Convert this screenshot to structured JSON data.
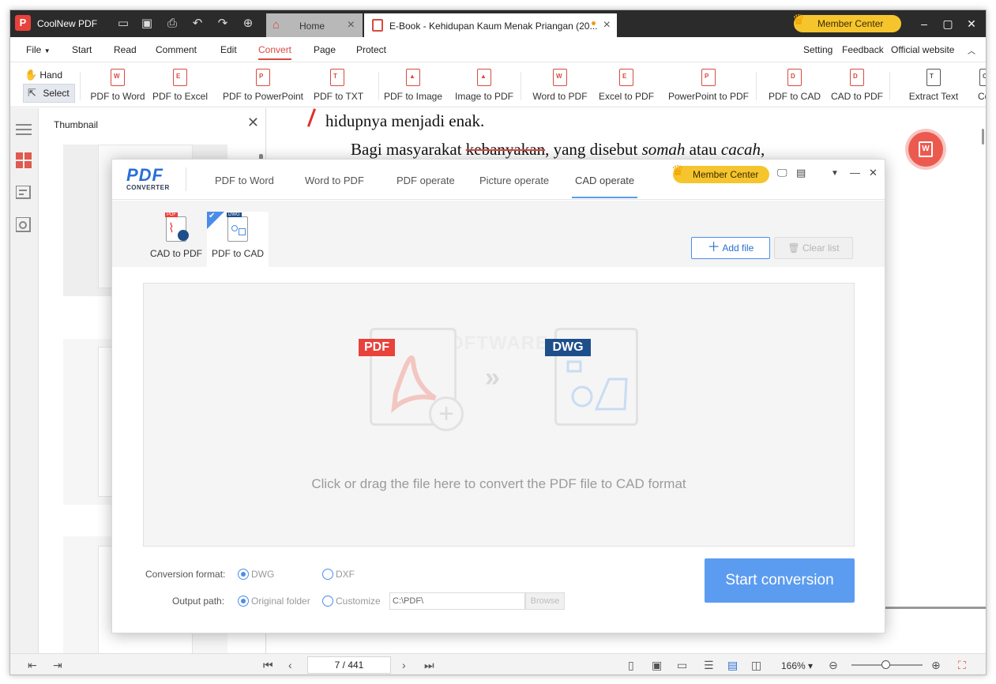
{
  "app": {
    "name": "CoolNew PDF",
    "logo_letter": "P",
    "tabs": [
      {
        "label": "Home"
      },
      {
        "label": "E-Book - Kehidupan Kaum Menak Priangan (20..."
      }
    ],
    "member_center": "Member Center",
    "accent": "#d84a40"
  },
  "menu": {
    "items": [
      "File",
      "Start",
      "Read",
      "Comment",
      "Edit",
      "Convert",
      "Page",
      "Protect"
    ],
    "right": [
      "Setting",
      "Feedback",
      "Official website"
    ],
    "active": "Convert"
  },
  "ribbon": {
    "hand": "Hand",
    "select": "Select",
    "buttons": [
      {
        "label": "PDF to Word",
        "glyph": "W"
      },
      {
        "label": "PDF to Excel",
        "glyph": "E"
      },
      {
        "label": "PDF to PowerPoint",
        "glyph": "P"
      },
      {
        "label": "PDF to TXT",
        "glyph": "T"
      },
      {
        "label": "PDF to Image",
        "glyph": "▲"
      },
      {
        "label": "Image to PDF",
        "glyph": "▲"
      },
      {
        "label": "Word to PDF",
        "glyph": "W"
      },
      {
        "label": "Excel to PDF",
        "glyph": "E"
      },
      {
        "label": "PowerPoint to PDF",
        "glyph": "P"
      },
      {
        "label": "PDF to CAD",
        "glyph": "D"
      },
      {
        "label": "CAD to PDF",
        "glyph": "D"
      },
      {
        "label": "Extract Text",
        "glyph": "T"
      },
      {
        "label": "Con",
        "glyph": "C"
      }
    ]
  },
  "thumbnail": {
    "title": "Thumbnail"
  },
  "document": {
    "line1": "hidupnya menjadi enak.",
    "line2_a": "Bagi masyarakat ",
    "line2_strike": "kebanyakan",
    "line2_b": ", yang disebut ",
    "line2_i1": "somah",
    "line2_c": " atau ",
    "line2_i2": "cacah,",
    "float_glyph": "W"
  },
  "statusbar": {
    "page": "7 / 441",
    "zoom": "166%",
    "zoom_level_fraction": 0.48
  },
  "converter": {
    "logo": "PDF",
    "logo_sub": "CONVERTER",
    "tabs": [
      "PDF to Word",
      "Word to PDF",
      "PDF operate",
      "Picture operate",
      "CAD operate"
    ],
    "active_tab": "CAD operate",
    "member_center": "Member Center",
    "subtabs": [
      {
        "label": "CAD to PDF",
        "tag": "PDF"
      },
      {
        "label": "PDF to CAD",
        "tag": "DWG"
      }
    ],
    "add_file": "Add file",
    "clear_list": "Clear list",
    "drop_text": "Click or drag the file here to convert the PDF file to CAD format",
    "tag_pdf": "PDF",
    "tag_dwg": "DWG",
    "watermark": "THESOFTWARE.SHOP",
    "conversion_format_label": "Conversion format:",
    "format_options": [
      "DWG",
      "DXF"
    ],
    "format_selected": "DWG",
    "output_path_label": "Output path:",
    "path_options": [
      "Original folder",
      "Customize"
    ],
    "path_selected": "Original folder",
    "path_value": "C:\\PDF\\",
    "browse": "Browse",
    "start": "Start conversion",
    "accent": "#5b9cf0"
  }
}
